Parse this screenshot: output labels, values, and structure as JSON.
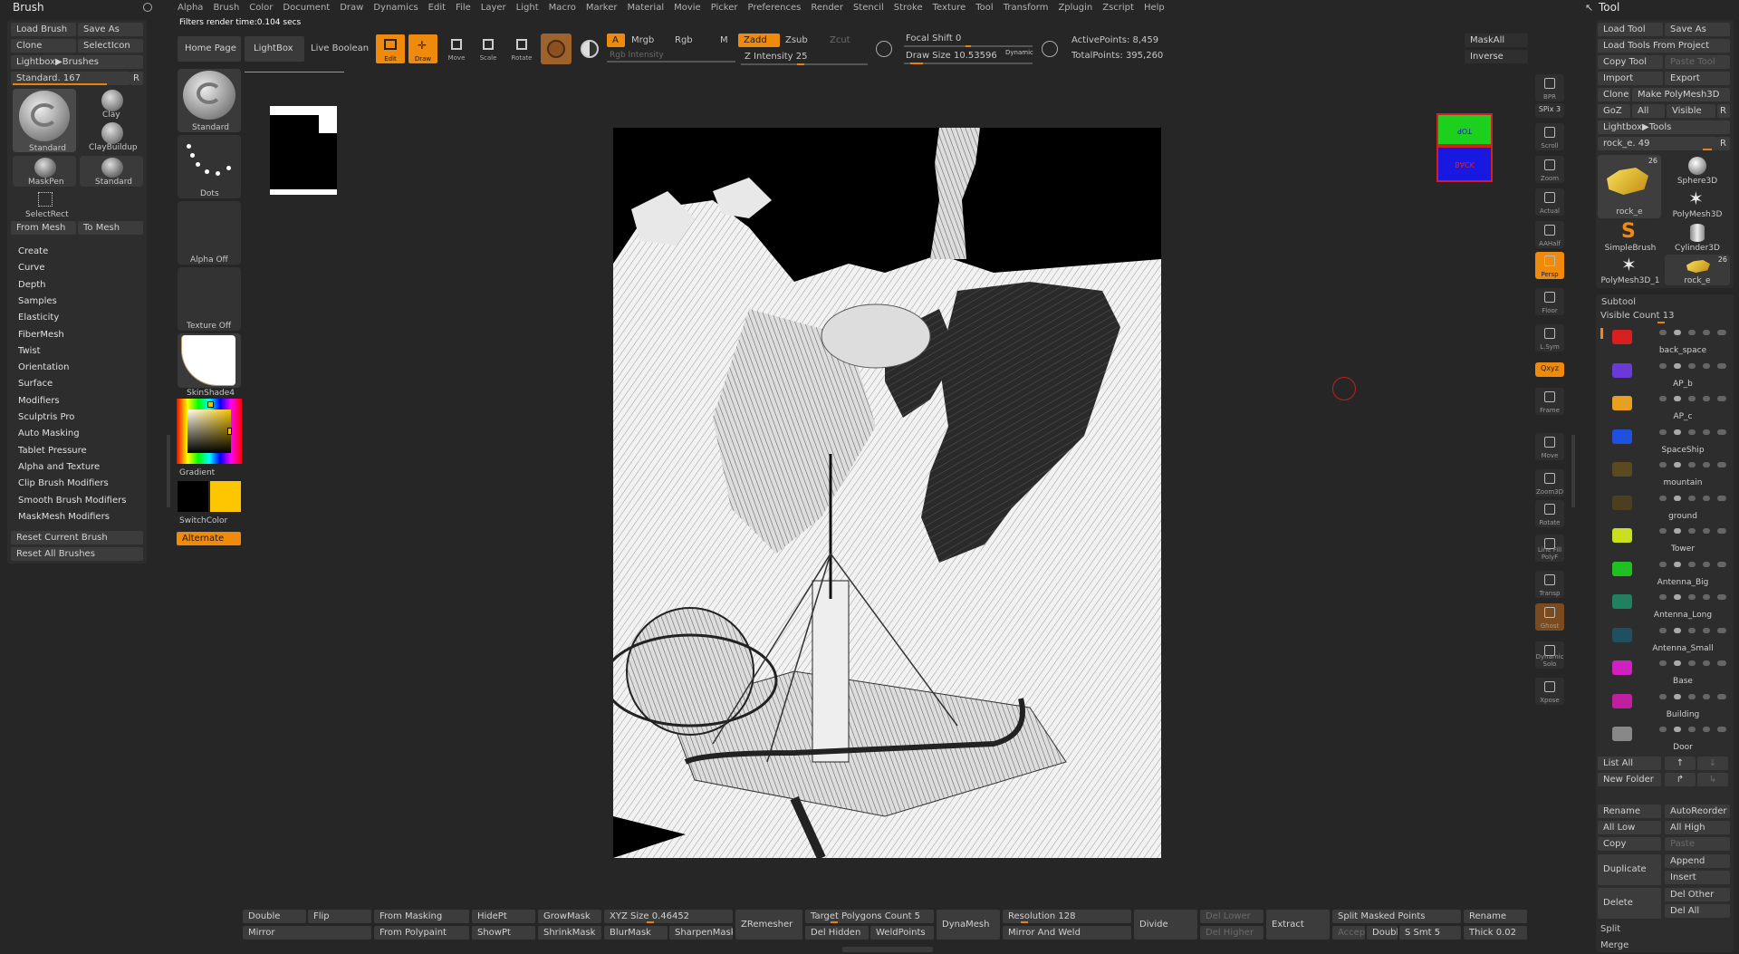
{
  "colors": {
    "accent": "#ef8a0c",
    "panel": "#2d2d2d",
    "bg": "#262626"
  },
  "menu": [
    "Alpha",
    "Brush",
    "Color",
    "Document",
    "Draw",
    "Dynamics",
    "Edit",
    "File",
    "Layer",
    "Light",
    "Macro",
    "Marker",
    "Material",
    "Movie",
    "Picker",
    "Preferences",
    "Render",
    "Stencil",
    "Stroke",
    "Texture",
    "Tool",
    "Transform",
    "Zplugin",
    "Zscript",
    "Help"
  ],
  "status": "Filters render time:0.104 secs",
  "brush": {
    "title": "Brush",
    "load": "Load Brush",
    "save_as": "Save As",
    "clone": "Clone",
    "select_icon": "SelectIcon",
    "lightbox": "Lightbox▶Brushes",
    "standard_value": "Standard. 167",
    "r": "R",
    "tiles": [
      "Standard",
      "Clay",
      "ClayBuildup",
      "MaskPen",
      "Standard",
      "SelectRect"
    ],
    "from_mesh": "From Mesh",
    "to_mesh": "To Mesh",
    "sections": [
      "Create",
      "Curve",
      "Depth",
      "Samples",
      "Elasticity",
      "FiberMesh",
      "Twist",
      "Orientation",
      "Surface",
      "Modifiers",
      "Sculptris Pro",
      "Auto Masking",
      "Tablet Pressure",
      "Alpha and Texture",
      "Clip Brush Modifiers",
      "Smooth Brush Modifiers",
      "MaskMesh Modifiers"
    ],
    "reset_current": "Reset Current Brush",
    "reset_all": "Reset All Brushes"
  },
  "shelf": {
    "standard": "Standard",
    "dots": "Dots",
    "alpha": "Alpha Off",
    "texture": "Texture Off",
    "material": "SkinShade4",
    "gradient": "Gradient",
    "switch_color": "SwitchColor",
    "alternate": "Alternate"
  },
  "top": {
    "home": "Home Page",
    "lightbox": "LightBox",
    "live_boolean": "Live Boolean",
    "edit": "Edit",
    "draw": "Draw",
    "move": "Move",
    "scale": "Scale",
    "rotate": "Rotate",
    "a": "A",
    "mrgb": "Mrgb",
    "rgb": "Rgb",
    "m": "M",
    "rgb_intensity": "Rgb Intensity",
    "zadd": "Zadd",
    "zsub": "Zsub",
    "zcut": "Zcut",
    "z_intensity": "Z Intensity 25",
    "focal_shift": "Focal Shift 0",
    "draw_size": "Draw Size 10.53596",
    "dynamic": "Dynamic",
    "active_points": "ActivePoints: 8,459",
    "total_points": "TotalPoints: 395,260",
    "mask_all": "MaskAll",
    "inverse": "Inverse"
  },
  "right_shelf": [
    "BPR",
    "SPix 3",
    "Scroll",
    "Zoom",
    "Actual",
    "AAHalf",
    "Persp",
    "Floor",
    "L.Sym",
    "Qxyz",
    "Frame",
    "Move",
    "Zoom3D",
    "Rotate",
    "Line Fill PolyF",
    "Transp",
    "Ghost",
    "Dynamic Solo",
    "Xpose"
  ],
  "cube": {
    "top": "TOP",
    "back": "BACK"
  },
  "tool": {
    "title": "Tool",
    "load": "Load Tool",
    "save_as": "Save As",
    "load_project": "Load Tools From Project",
    "copy": "Copy Tool",
    "paste": "Paste Tool",
    "import": "Import",
    "export": "Export",
    "clone": "Clone",
    "make_polymesh": "Make PolyMesh3D",
    "goz": "GoZ",
    "all": "All",
    "visible": "Visible",
    "r": "R",
    "lightbox": "Lightbox▶Tools",
    "rock_value": "rock_e. 49",
    "tiles": [
      {
        "label": "rock_e",
        "badge": "26"
      },
      {
        "label": "Sphere3D"
      },
      {
        "label": "PolyMesh3D"
      },
      {
        "label": "SimpleBrush"
      },
      {
        "label": "Cylinder3D"
      },
      {
        "label": "PolyMesh3D_1"
      },
      {
        "label": "rock_e",
        "badge": "26"
      }
    ],
    "subtool": "Subtool",
    "visible_count": "Visible Count 13",
    "subtools": [
      "back_space",
      "AP_b",
      "AP_c",
      "SpaceShip",
      "mountain",
      "ground",
      "Tower",
      "Antenna_Big",
      "Antenna_Long",
      "Antenna_Small",
      "Base",
      "Building",
      "Door"
    ],
    "subtool_colors": [
      "#d82020",
      "#6a3ad8",
      "#e8a020",
      "#2050e0",
      "#5a4a20",
      "#4a4020",
      "#c8e020",
      "#20c020",
      "#208060",
      "#205060",
      "#d020c0",
      "#c020a0",
      "#888"
    ],
    "list_all": "List All",
    "new_folder": "New Folder",
    "rename": "Rename",
    "auto_reorder": "AutoReorder",
    "all_low": "All Low",
    "all_high": "All High",
    "copy2": "Copy",
    "paste2": "Paste",
    "duplicate": "Duplicate",
    "append": "Append",
    "insert": "Insert",
    "delete": "Delete",
    "del_other": "Del Other",
    "del_all": "Del All",
    "split": "Split",
    "merge": "Merge"
  },
  "bottom": {
    "double": "Double",
    "flip": "Flip",
    "mirror": "Mirror",
    "from_masking": "From Masking",
    "from_polypaint": "From Polypaint",
    "hidept": "HidePt",
    "showpt": "ShowPt",
    "growmask": "GrowMask",
    "shrinkmask": "ShrinkMask",
    "xyz_size": "XYZ Size 0.46452",
    "blurmask": "BlurMask",
    "sharpenmask": "SharpenMask",
    "zremesher": "ZRemesher",
    "target_polys": "Target Polygons Count 5",
    "del_hidden": "Del Hidden",
    "weldpoints": "WeldPoints",
    "dynamesh": "DynaMesh",
    "resolution": "Resolution 128",
    "mirror_weld": "Mirror And Weld",
    "divide": "Divide",
    "del_lower": "Del Lower",
    "del_higher": "Del Higher",
    "extract": "Extract",
    "split_masked": "Split Masked Points",
    "accept": "Accept",
    "double2": "Double",
    "s_smt": "S Smt 5",
    "rename": "Rename",
    "thick": "Thick 0.02"
  }
}
